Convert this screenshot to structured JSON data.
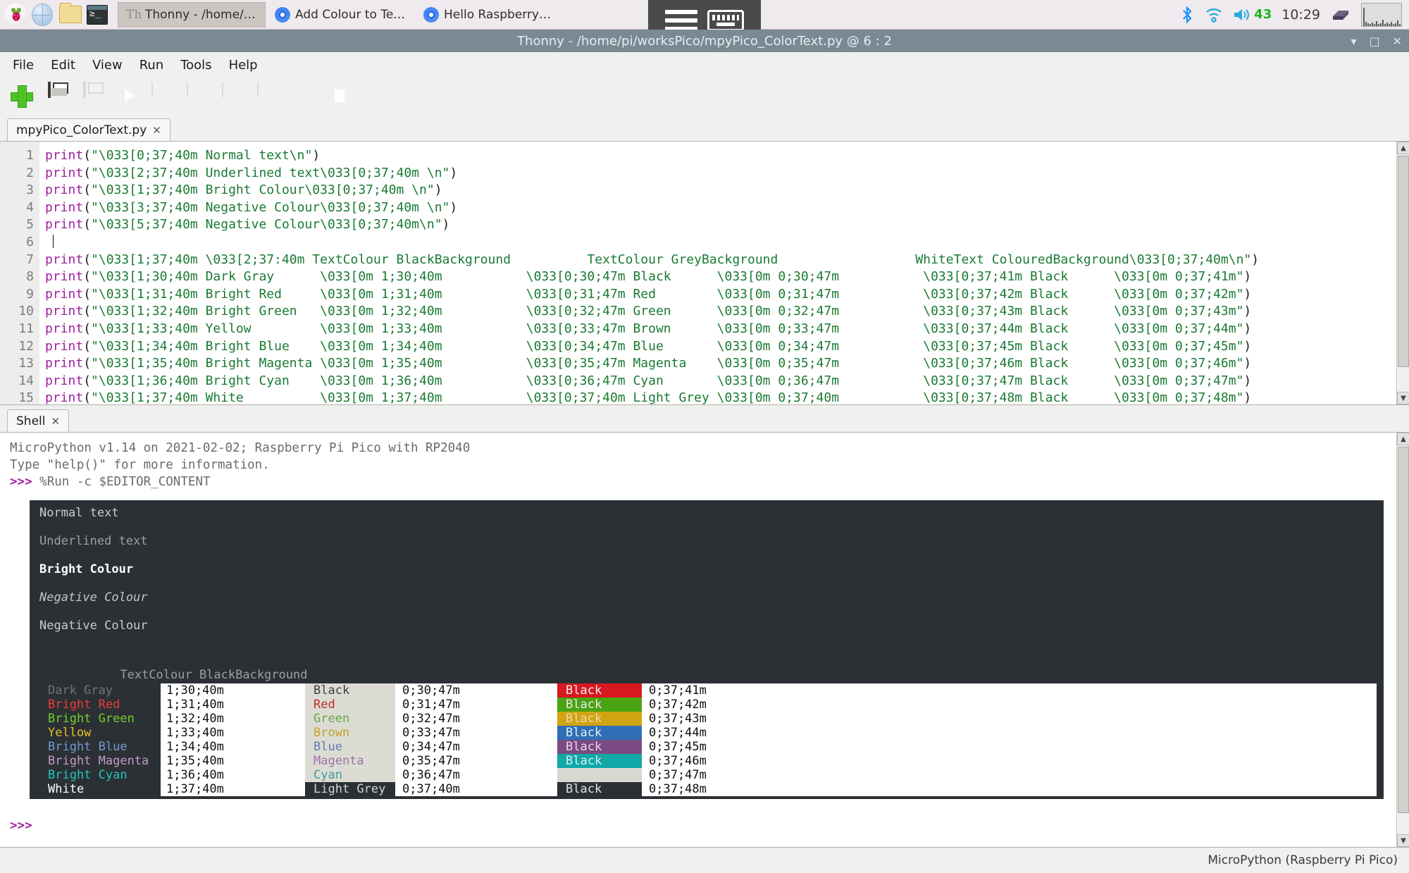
{
  "taskbar": {
    "launchers": [
      {
        "name": "raspberry-menu",
        "glyph": "❦"
      },
      {
        "name": "web-browser",
        "glyph": ""
      },
      {
        "name": "file-manager",
        "glyph": ""
      },
      {
        "name": "terminal",
        "glyph": ""
      }
    ],
    "windows": [
      {
        "label": "Thonny  -  /home/pi/...",
        "icon": "thonny-icon",
        "active": true
      },
      {
        "label": "Add Colour to Text in ...",
        "icon": "chrome-icon",
        "active": false
      },
      {
        "label": "Hello Raspberry Pi - C...",
        "icon": "chrome-icon",
        "active": false
      }
    ],
    "tray": {
      "bluetooth": "bluetooth-icon",
      "wifi": "wifi-icon",
      "volume_icon": "volume-icon",
      "volume_value": "43",
      "clock": "10:29",
      "cpu_icon": "cpu-chip-icon",
      "cpu_graph": "cpu-usage-graph"
    },
    "center_widget": {
      "handle": "drag-handle-icon",
      "keyboard": "onscreen-keyboard-icon"
    }
  },
  "window": {
    "title": "Thonny  -  /home/pi/worksPico/mpyPico_ColorText.py  @  6 : 2",
    "controls": [
      "minimize",
      "maximize",
      "close"
    ]
  },
  "menubar": [
    "File",
    "Edit",
    "View",
    "Run",
    "Tools",
    "Help"
  ],
  "toolbar": [
    {
      "name": "new-file-button",
      "icon": "plus-icon",
      "enabled": true
    },
    {
      "name": "save-file-button",
      "icon": "floppy-disk-icon",
      "enabled": true
    },
    {
      "name": "open-file-button",
      "icon": "load-icon",
      "enabled": false
    },
    {
      "name": "run-button",
      "icon": "play-icon",
      "enabled": true
    },
    {
      "name": "debug-button",
      "icon": "debug-icon",
      "enabled": false
    },
    {
      "name": "step-over-button",
      "icon": "step-over-icon",
      "enabled": false
    },
    {
      "name": "step-into-button",
      "icon": "step-into-icon",
      "enabled": false
    },
    {
      "name": "step-out-button",
      "icon": "step-out-icon",
      "enabled": false
    },
    {
      "name": "resume-button",
      "icon": "resume-icon",
      "enabled": false
    },
    {
      "name": "stop-button",
      "icon": "stop-icon",
      "enabled": true
    }
  ],
  "editor": {
    "tab_label": "mpyPico_ColorText.py",
    "tab_close": "✕",
    "line_numbers": [
      "1",
      "2",
      "3",
      "4",
      "5",
      "6",
      "7",
      "8",
      "9",
      "10",
      "11",
      "12",
      "13",
      "14",
      "15"
    ],
    "lines": [
      "print(\"\\033[0;37;40m Normal text\\n\")",
      "print(\"\\033[2;37;40m Underlined text\\033[0;37;40m \\n\")",
      "print(\"\\033[1;37;40m Bright Colour\\033[0;37;40m \\n\")",
      "print(\"\\033[3;37;40m Negative Colour\\033[0;37;40m \\n\")",
      "print(\"\\033[5;37;40m Negative Colour\\033[0;37;40m\\n\")",
      "",
      "print(\"\\033[1;37;40m \\033[2;37:40m TextColour BlackBackground          TextColour GreyBackground                  WhiteText ColouredBackground\\033[0;37;40m\\n\")",
      "print(\"\\033[1;30;40m Dark Gray      \\033[0m 1;30;40m           \\033[0;30;47m Black      \\033[0m 0;30;47m           \\033[0;37;41m Black      \\033[0m 0;37;41m\")",
      "print(\"\\033[1;31;40m Bright Red     \\033[0m 1;31;40m           \\033[0;31;47m Red        \\033[0m 0;31;47m           \\033[0;37;42m Black      \\033[0m 0;37;42m\")",
      "print(\"\\033[1;32;40m Bright Green   \\033[0m 1;32;40m           \\033[0;32;47m Green      \\033[0m 0;32;47m           \\033[0;37;43m Black      \\033[0m 0;37;43m\")",
      "print(\"\\033[1;33;40m Yellow         \\033[0m 1;33;40m           \\033[0;33;47m Brown      \\033[0m 0;33;47m           \\033[0;37;44m Black      \\033[0m 0;37;44m\")",
      "print(\"\\033[1;34;40m Bright Blue    \\033[0m 1;34;40m           \\033[0;34;47m Blue       \\033[0m 0;34;47m           \\033[0;37;45m Black      \\033[0m 0;37;45m\")",
      "print(\"\\033[1;35;40m Bright Magenta \\033[0m 1;35;40m           \\033[0;35;47m Magenta    \\033[0m 0;35;47m           \\033[0;37;46m Black      \\033[0m 0;37;46m\")",
      "print(\"\\033[1;36;40m Bright Cyan    \\033[0m 1;36;40m           \\033[0;36;47m Cyan       \\033[0m 0;36;47m           \\033[0;37;47m Black      \\033[0m 0;37;47m\")",
      "print(\"\\033[1;37;40m White          \\033[0m 1;37;40m           \\033[0;37;40m Light Grey \\033[0m 0;37;40m           \\033[0;37;48m Black      \\033[0m 0;37;48m\")"
    ]
  },
  "shell": {
    "tab_label": "Shell",
    "tab_close": "✕",
    "banner_line1": "MicroPython v1.14 on 2021-02-02; Raspberry Pi Pico with RP2040",
    "banner_line2": "Type \"help()\" for more information.",
    "prompt": ">>>",
    "command": "%Run -c $EDITOR_CONTENT",
    "final_prompt": ">>>",
    "output": {
      "demo_lines": [
        {
          "text": "Normal text",
          "style": "normal"
        },
        {
          "text": "Underlined text",
          "style": "dim"
        },
        {
          "text": "Bright Colour",
          "style": "bold"
        },
        {
          "text": "Negative Colour",
          "style": "italic"
        },
        {
          "text": "Negative Colour",
          "style": "normal"
        }
      ],
      "headers": [
        "TextColour BlackBackground",
        "TextColour GreyBackground",
        "WhiteText ColouredBackground"
      ],
      "rows": [
        {
          "black_name": "Dark Gray",
          "black_code": "1;30;40m",
          "black_fg": "#6e7478",
          "black_bg": "#2b3035",
          "grey_name": "Black",
          "grey_code": "0;30;47m",
          "grey_fg": "#3d4247",
          "grey_bg": "#dcdcd4",
          "col_name": "Black",
          "col_code": "0;37;41m",
          "col_fg": "#f2f2f2",
          "col_bg": "#d81820"
        },
        {
          "black_name": "Bright Red",
          "black_code": "1;31;40m",
          "black_fg": "#ef3b3b",
          "black_bg": "#2b3035",
          "grey_name": "Red",
          "grey_code": "0;31;47m",
          "grey_fg": "#c2292e",
          "grey_bg": "#dcdcd4",
          "col_name": "Black",
          "col_code": "0;37;42m",
          "col_fg": "#eaeaea",
          "col_bg": "#4aa312"
        },
        {
          "black_name": "Bright Green",
          "black_code": "1;32;40m",
          "black_fg": "#76cf2e",
          "black_bg": "#2b3035",
          "grey_name": "Green",
          "grey_code": "0;32;47m",
          "grey_fg": "#63a844",
          "grey_bg": "#dcdcd4",
          "col_name": "Black",
          "col_code": "0;37;43m",
          "col_fg": "#ecdca8",
          "col_bg": "#d2a411"
        },
        {
          "black_name": "Yellow",
          "black_code": "1;33;40m",
          "black_fg": "#e6c01c",
          "black_bg": "#2b3035",
          "grey_name": "Brown",
          "grey_code": "0;33;47m",
          "grey_fg": "#c3a229",
          "grey_bg": "#dcdcd4",
          "col_name": "Black",
          "col_code": "0;37;44m",
          "col_fg": "#e7edf4",
          "col_bg": "#2f6fb5"
        },
        {
          "black_name": "Bright Blue",
          "black_code": "1;34;40m",
          "black_fg": "#6f9bd2",
          "black_bg": "#2b3035",
          "grey_name": "Blue",
          "grey_code": "0;34;47m",
          "grey_fg": "#5a7fae",
          "grey_bg": "#dcdcd4",
          "col_name": "Black",
          "col_code": "0;37;45m",
          "col_fg": "#e6d8e8",
          "col_bg": "#7b4a82"
        },
        {
          "black_name": "Bright Magenta",
          "black_code": "1;35;40m",
          "black_fg": "#c39ac8",
          "black_bg": "#2b3035",
          "grey_name": "Magenta",
          "grey_code": "0;35;47m",
          "grey_fg": "#9b73a3",
          "grey_bg": "#dcdcd4",
          "col_name": "Black",
          "col_code": "0;37;46m",
          "col_fg": "#d8f0f0",
          "col_bg": "#11a8a8"
        },
        {
          "black_name": "Bright Cyan",
          "black_code": "1;36;40m",
          "black_fg": "#23c6bd",
          "black_bg": "#2b3035",
          "grey_name": "Cyan",
          "grey_code": "0;36;47m",
          "grey_fg": "#3f9d9d",
          "grey_bg": "#dcdcd4",
          "col_name": "",
          "col_code": "0;37;47m",
          "col_fg": "#ffffff",
          "col_bg": "#d8d8d0"
        },
        {
          "black_name": "White",
          "black_code": "1;37;40m",
          "black_fg": "#ffffff",
          "black_bg": "#2b3035",
          "grey_name": "Light Grey",
          "grey_code": "0;37;40m",
          "grey_fg": "#d5d5cd",
          "grey_bg": "#2b3035",
          "col_name": "Black",
          "col_code": "0;37;48m",
          "col_fg": "#dfe2e4",
          "col_bg": "transparent"
        }
      ]
    }
  },
  "statusbar": {
    "interpreter": "MicroPython (Raspberry Pi Pico)"
  },
  "colors": {
    "terminal_bg": "#2b3035",
    "taskbar_bg": "#efeaee",
    "titlebar_bg": "#7a8a94",
    "accent_green": "#17b71b",
    "prompt_purple": "#a020a0",
    "string_green": "#1a7a32",
    "keyword_purple": "#a020a0"
  }
}
